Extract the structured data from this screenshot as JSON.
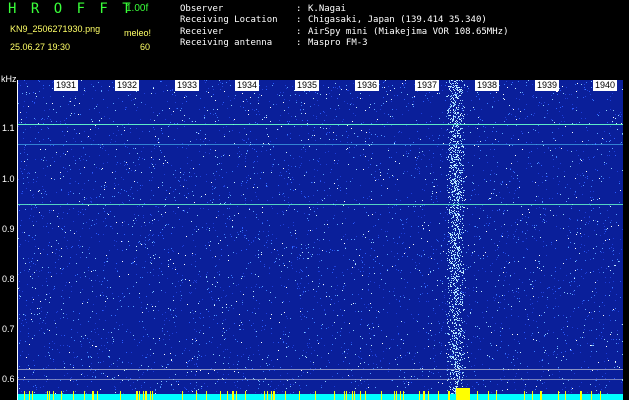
{
  "header": {
    "app_title": "H R O F F T",
    "version": "1.00f",
    "filename": "KN9_2506271930.png",
    "datetime": "25.06.27 19:30",
    "mode_label": "meleo!",
    "mode_value": "60"
  },
  "info": [
    {
      "label": "Observer",
      "sep": ":",
      "value": "K.Nagai"
    },
    {
      "label": "Receiving Location",
      "sep": ":",
      "value": "Chigasaki, Japan (139.414 35.340)"
    },
    {
      "label": "Receiver",
      "sep": ":",
      "value": "AirSpy mini (Miakejima VOR 108.65MHz)"
    },
    {
      "label": "Receiving antenna",
      "sep": ":",
      "value": "Maspro FM-3"
    }
  ],
  "axes": {
    "y_unit": "kHz",
    "y_ticks": [
      "1.1",
      "1.0",
      "0.9",
      "0.8",
      "0.7",
      "0.6"
    ],
    "x_ticks": [
      "1931",
      "1932",
      "1933",
      "1934",
      "1935",
      "1936",
      "1937",
      "1938",
      "1939",
      "1940"
    ]
  },
  "colors": {
    "background": "#000000",
    "spectrogram_base": "#0a1f9a",
    "title_green": "#39ff39",
    "label_yellow": "#ffff66",
    "trace_cyan": "#66ffcc",
    "bottom_band": "#00ffff"
  }
}
